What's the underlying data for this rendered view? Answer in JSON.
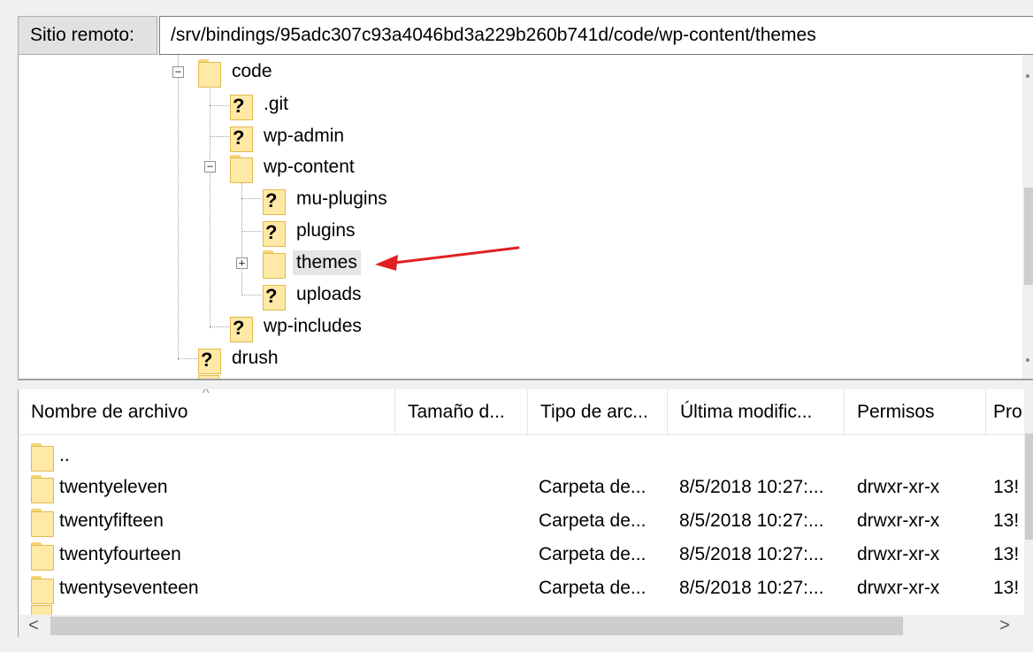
{
  "remote_site": {
    "label": "Sitio remoto:",
    "path": "/srv/bindings/95adc307c93a4046bd3a229b260b741d/code/wp-content/themes"
  },
  "tree": {
    "nodes": [
      {
        "name": "code",
        "icon": "folder-icon",
        "expanded": true
      },
      {
        "name": ".git",
        "icon": "unknown-folder-icon"
      },
      {
        "name": "wp-admin",
        "icon": "unknown-folder-icon"
      },
      {
        "name": "wp-content",
        "icon": "folder-icon",
        "expanded": true
      },
      {
        "name": "mu-plugins",
        "icon": "unknown-folder-icon"
      },
      {
        "name": "plugins",
        "icon": "unknown-folder-icon"
      },
      {
        "name": "themes",
        "icon": "folder-icon",
        "expanded": false,
        "selected": true
      },
      {
        "name": "uploads",
        "icon": "unknown-folder-icon"
      },
      {
        "name": "wp-includes",
        "icon": "unknown-folder-icon"
      },
      {
        "name": "drush",
        "icon": "unknown-folder-icon"
      }
    ],
    "expander_collapse": "−",
    "expander_expand": "+",
    "unknown_mark": "?"
  },
  "annotation": {
    "arrow_color": "#e02020"
  },
  "file_list": {
    "columns": [
      "Nombre de archivo",
      "Tamaño d...",
      "Tipo de arc...",
      "Última modific...",
      "Permisos",
      "Pro"
    ],
    "rows": [
      {
        "name": "..",
        "size": "",
        "type": "",
        "modified": "",
        "perms": "",
        "owner": ""
      },
      {
        "name": "twentyeleven",
        "size": "",
        "type": "Carpeta de...",
        "modified": "8/5/2018 10:27:...",
        "perms": "drwxr-xr-x",
        "owner": "13!"
      },
      {
        "name": "twentyfifteen",
        "size": "",
        "type": "Carpeta de...",
        "modified": "8/5/2018 10:27:...",
        "perms": "drwxr-xr-x",
        "owner": "13!"
      },
      {
        "name": "twentyfourteen",
        "size": "",
        "type": "Carpeta de...",
        "modified": "8/5/2018 10:27:...",
        "perms": "drwxr-xr-x",
        "owner": "13!"
      },
      {
        "name": "twentyseventeen",
        "size": "",
        "type": "Carpeta de...",
        "modified": "8/5/2018 10:27:...",
        "perms": "drwxr-xr-x",
        "owner": "13!"
      }
    ],
    "scroll_left": "<",
    "scroll_right": ">"
  }
}
